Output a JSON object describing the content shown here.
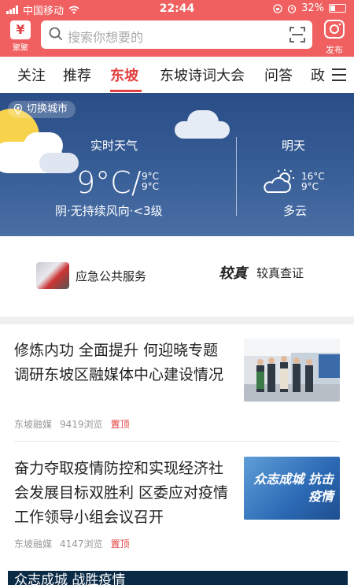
{
  "status_bar": {
    "carrier": "中国移动",
    "time": "22:44",
    "battery": "32%"
  },
  "header": {
    "logo_text": "聚聚",
    "search_placeholder": "搜索你想要的",
    "publish_label": "发布",
    "accent_color": "#f06060"
  },
  "tabs": [
    {
      "label": "关注"
    },
    {
      "label": "推荐"
    },
    {
      "label": "东坡",
      "active": true
    },
    {
      "label": "东坡诗词大会"
    },
    {
      "label": "问答"
    },
    {
      "label": "政"
    }
  ],
  "weather": {
    "switch_city": "切换城市",
    "now_label": "实时天气",
    "now_temp": "9°C/",
    "now_high": "9°C",
    "now_low": "9°C",
    "now_desc": "阴·无持续风向·<3级",
    "tomorrow_label": "明天",
    "tomorrow_high": "16°C",
    "tomorrow_low": "9°C",
    "tomorrow_desc": "多云"
  },
  "services": [
    {
      "label": "应急公共服务",
      "icon": "emergency-service-icon"
    },
    {
      "label": "较真查证",
      "icon": "fact-check-logo",
      "logo_text": "较真"
    }
  ],
  "news": [
    {
      "title": "修炼内功 全面提升 何迎晓专题调研东坡区融媒体中心建设情况",
      "source": "东坡融媒",
      "views": "9419浏览",
      "tag": "置顶"
    },
    {
      "title": "奋力夺取疫情防控和实现经济社会发展目标双胜利 区委应对疫情工作领导小组会议召开",
      "source": "东坡融媒",
      "views": "4147浏览",
      "tag": "置顶",
      "image_text": "众志成城 抗击疫情"
    }
  ],
  "bottom_banner": "众志成城 战胜疫情"
}
